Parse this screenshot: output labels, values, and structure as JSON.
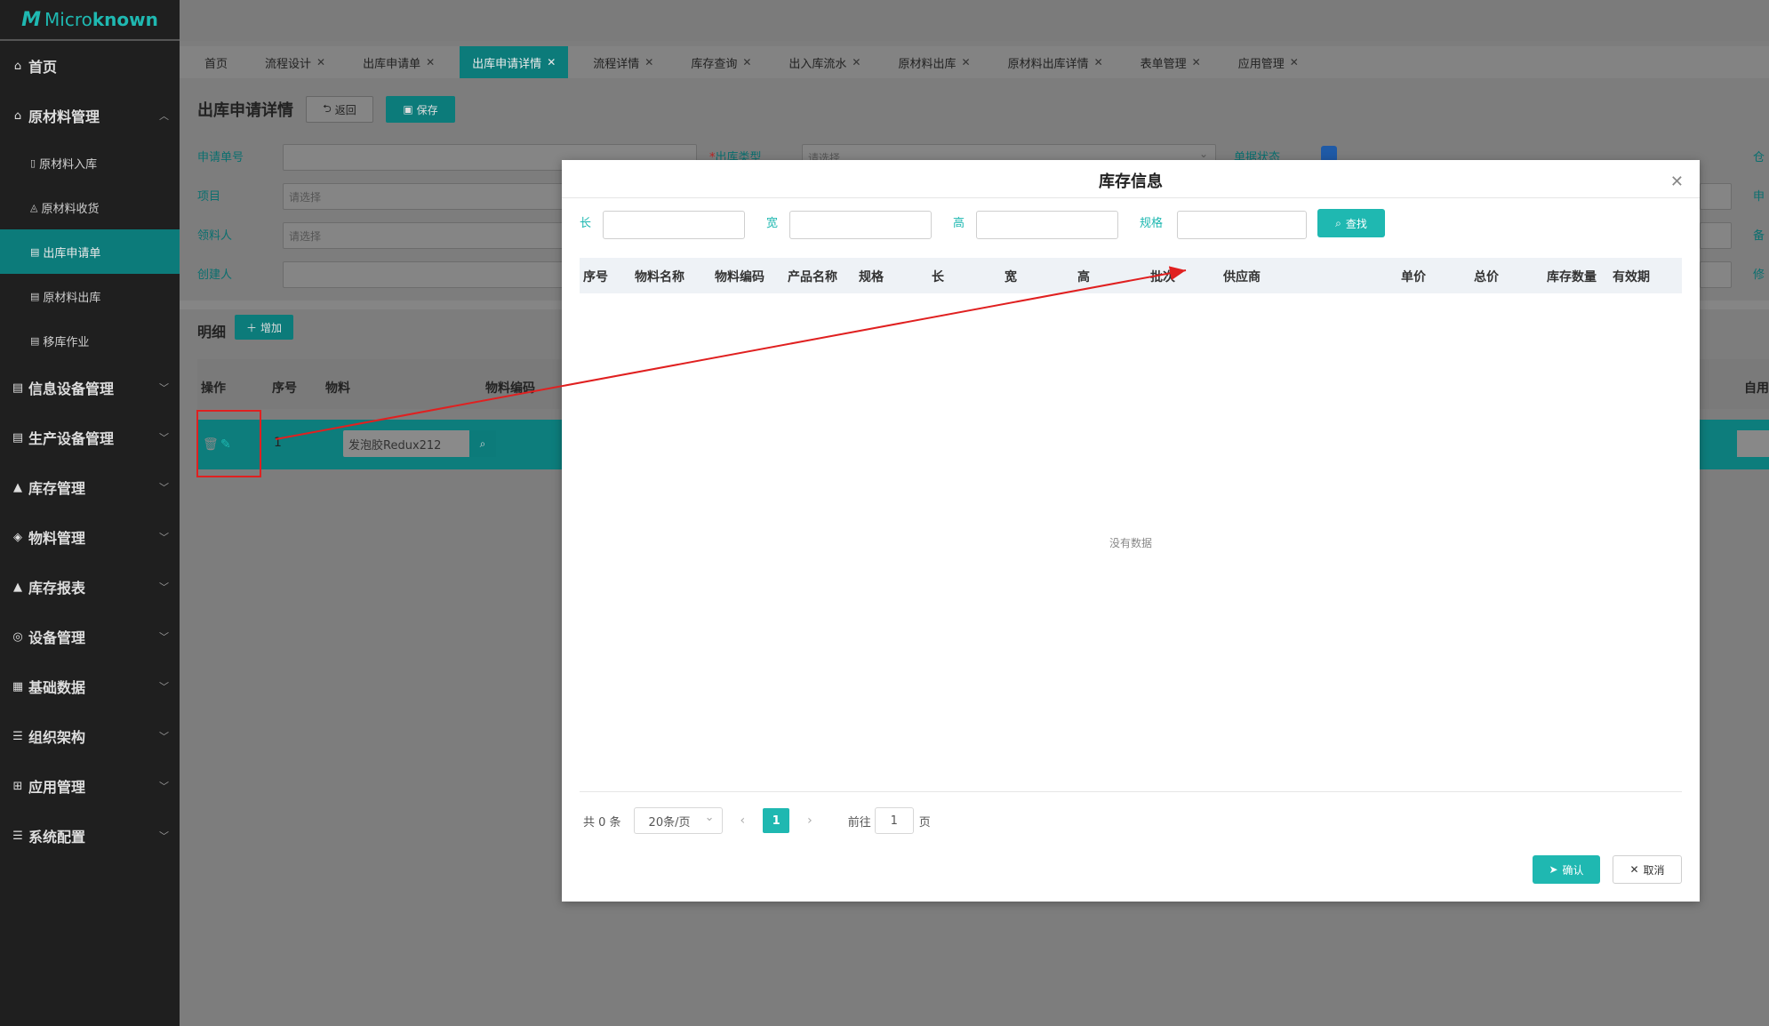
{
  "brand": {
    "mark": "M",
    "name_prefix": "Micro",
    "name_suffix": "known"
  },
  "sidebar": {
    "items": [
      {
        "label": "首页",
        "icon": "home-icon",
        "glyph": "⌂"
      },
      {
        "label": "原材料管理",
        "icon": "home-icon",
        "glyph": "⌂",
        "expanded": true
      },
      {
        "label": "信息设备管理",
        "icon": "building-icon",
        "glyph": "▤"
      },
      {
        "label": "生产设备管理",
        "icon": "building-icon",
        "glyph": "▤"
      },
      {
        "label": "库存管理",
        "icon": "boxes-icon",
        "glyph": "▲"
      },
      {
        "label": "物料管理",
        "icon": "box-icon",
        "glyph": "◈"
      },
      {
        "label": "库存报表",
        "icon": "boxes-icon",
        "glyph": "▲"
      },
      {
        "label": "设备管理",
        "icon": "cube-icon",
        "glyph": "◎"
      },
      {
        "label": "基础数据",
        "icon": "database-icon",
        "glyph": "▦"
      },
      {
        "label": "组织架构",
        "icon": "sliders-icon",
        "glyph": "☰"
      },
      {
        "label": "应用管理",
        "icon": "grid-icon",
        "glyph": "⊞"
      },
      {
        "label": "系统配置",
        "icon": "sliders-icon",
        "glyph": "☰"
      }
    ],
    "sub_items": [
      {
        "label": "原材料入库",
        "icon": "doc-icon"
      },
      {
        "label": "原材料收货",
        "icon": "truck-icon"
      },
      {
        "label": "出库申请单",
        "icon": "building-icon",
        "active": true
      },
      {
        "label": "原材料出库",
        "icon": "building-icon"
      },
      {
        "label": "移库作业",
        "icon": "building-icon"
      }
    ]
  },
  "tabs": [
    {
      "label": "首页",
      "closable": false
    },
    {
      "label": "流程设计",
      "closable": true
    },
    {
      "label": "出库申请单",
      "closable": true
    },
    {
      "label": "出库申请详情",
      "closable": true,
      "active": true
    },
    {
      "label": "流程详情",
      "closable": true
    },
    {
      "label": "库存查询",
      "closable": true
    },
    {
      "label": "出入库流水",
      "closable": true
    },
    {
      "label": "原材料出库",
      "closable": true
    },
    {
      "label": "原材料出库详情",
      "closable": true
    },
    {
      "label": "表单管理",
      "closable": true
    },
    {
      "label": "应用管理",
      "closable": true
    }
  ],
  "page": {
    "title": "出库申请详情",
    "back_label": "返回",
    "save_label": "保存",
    "form": {
      "apply_no_label": "申请单号",
      "out_type_label": "出库类型",
      "out_type_placeholder": "请选择",
      "status_label": "单据状态",
      "project_label": "项目",
      "project_placeholder": "请选择",
      "receiver_label": "领料人",
      "receiver_placeholder": "请选择",
      "creator_label": "创建人",
      "right_labels": [
        "仓",
        "申",
        "备",
        "修"
      ]
    },
    "detail": {
      "title": "明细",
      "add_label": "增加",
      "headers": {
        "op": "操作",
        "seq": "序号",
        "material": "物料",
        "material_code": "物料编码",
        "self_use": "自用"
      },
      "row": {
        "seq": "1",
        "material": "发泡胶Redux212"
      }
    }
  },
  "modal": {
    "title": "库存信息",
    "filters": {
      "length": "长",
      "width": "宽",
      "height": "高",
      "spec": "规格"
    },
    "find_label": "查找",
    "columns": [
      "序号",
      "物料名称",
      "物料编码",
      "产品名称",
      "规格",
      "长",
      "宽",
      "高",
      "批次",
      "供应商",
      "单价",
      "总价",
      "库存数量",
      "有效期"
    ],
    "empty_text": "没有数据",
    "pager": {
      "total": "共 0 条",
      "size": "20条/页",
      "current": "1",
      "goto_prefix": "前往",
      "goto_value": "1",
      "goto_suffix": "页"
    },
    "ok_label": "确认",
    "cancel_label": "取消"
  },
  "colors": {
    "accent": "#1fb8b1",
    "annotation": "#e02020"
  }
}
